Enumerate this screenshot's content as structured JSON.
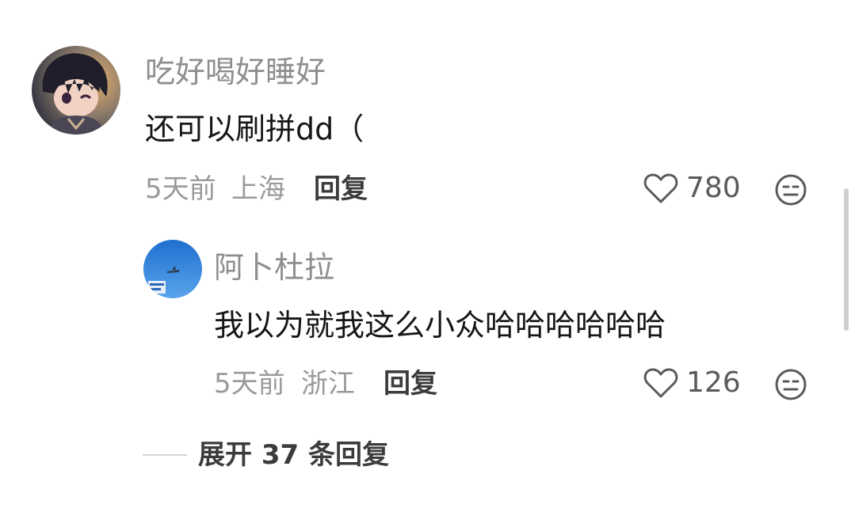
{
  "comments": [
    {
      "username": "吃好喝好睡好",
      "content": "还可以刷拼dd（",
      "time": "5天前",
      "location": "上海",
      "reply_label": "回复",
      "likes": "780",
      "avatar_icon": "anime-character-avatar"
    }
  ],
  "replies": [
    {
      "username": "阿卜杜拉",
      "content": "我以为就我这么小众哈哈哈哈哈哈",
      "time": "5天前",
      "location": "浙江",
      "reply_label": "回复",
      "likes": "126",
      "avatar_icon": "sky-airplane-avatar"
    }
  ],
  "expand": {
    "label": "展开 37 条回复"
  },
  "colors": {
    "username": "#8e8e8e",
    "content": "#161616",
    "meta": "#9a9a9a",
    "action": "#3c3c3c"
  }
}
